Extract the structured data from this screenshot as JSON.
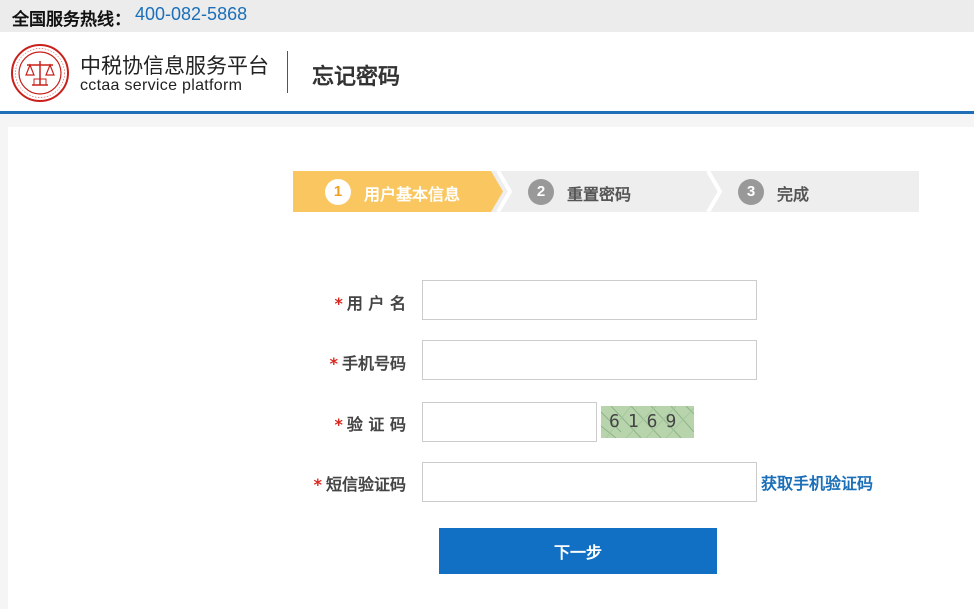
{
  "hotline": {
    "label": "全国服务热线：",
    "number": "400-082-5868"
  },
  "header": {
    "brand_cn": "中税协信息服务平台",
    "brand_en": "cctaa  service platform",
    "page_title": "忘记密码"
  },
  "steps": [
    {
      "num": "1",
      "label": "用户基本信息",
      "state": "active"
    },
    {
      "num": "2",
      "label": "重置密码",
      "state": "inactive"
    },
    {
      "num": "3",
      "label": "完成",
      "state": "inactive"
    }
  ],
  "form": {
    "required_mark": "*",
    "username": {
      "label": "用 户 名",
      "value": ""
    },
    "phone": {
      "label": "手机号码",
      "value": ""
    },
    "captcha": {
      "label": "验 证 码",
      "value": "",
      "image_text": "6169"
    },
    "sms_code": {
      "label": "短信验证码",
      "value": ""
    },
    "get_sms_label": "获取手机验证码",
    "next_label": "下一步"
  },
  "colors": {
    "accent": "#1170c4",
    "step_active": "#f9c660",
    "required": "#d9261c",
    "link": "#1a6fb8"
  }
}
